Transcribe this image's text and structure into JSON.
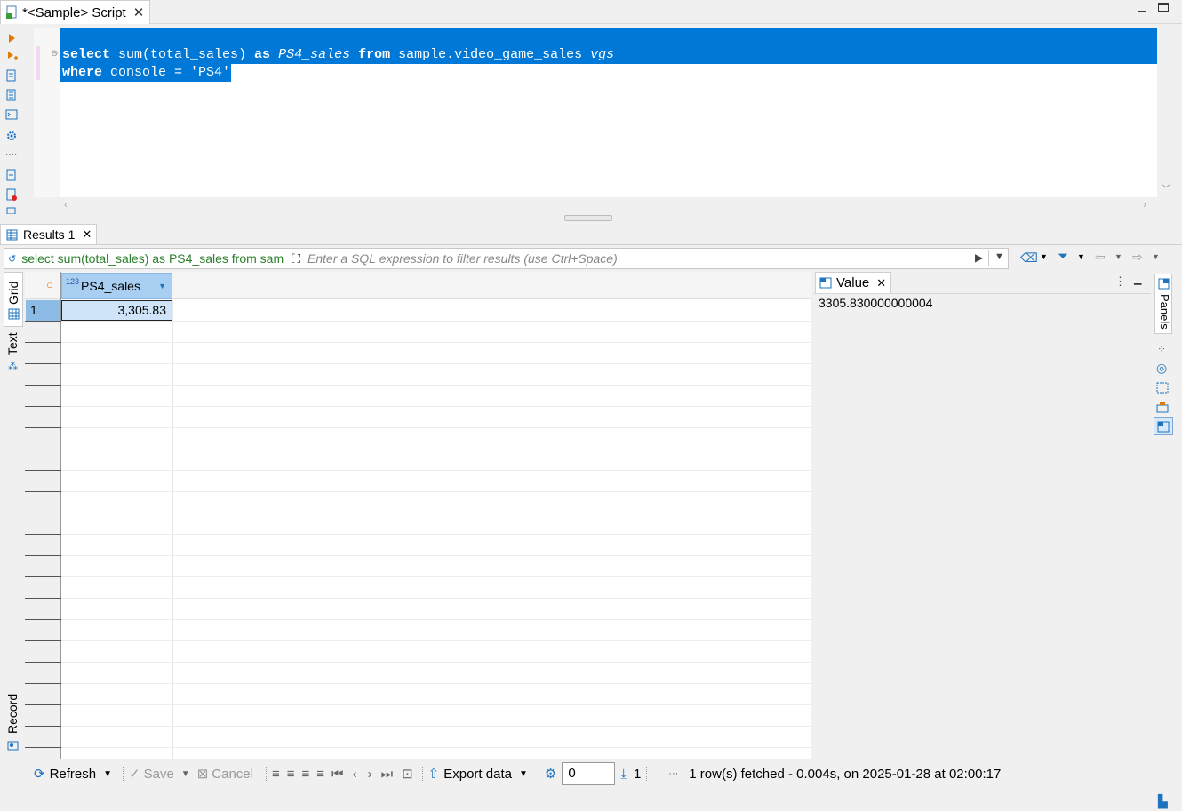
{
  "editor_tab": {
    "title": "*<Sample> Script"
  },
  "sql": {
    "line1": {
      "kw1": "select",
      "t1": " sum(total_sales) ",
      "kw2": "as",
      "t2": " ",
      "alias": "PS4_sales",
      "t3": " ",
      "kw3": "from",
      "t4": " sample.video_game_sales ",
      "alias2": "vgs"
    },
    "line2": {
      "kw1": "where",
      "t1": " console = 'PS4'"
    }
  },
  "results_tab": {
    "label": "Results 1"
  },
  "filter": {
    "query": "select sum(total_sales) as PS4_sales from sam",
    "placeholder": "Enter a SQL expression to filter results (use Ctrl+Space)"
  },
  "side_tabs": {
    "grid": "Grid",
    "text": "Text",
    "record": "Record"
  },
  "grid": {
    "column": {
      "type_badge": "123",
      "name": "PS4_sales"
    },
    "rows": [
      {
        "num": "1",
        "value": "3,305.83"
      }
    ]
  },
  "value_panel": {
    "title": "Value",
    "value": "3305.830000000004"
  },
  "panels_tab": {
    "label": "Panels"
  },
  "toolbar": {
    "refresh": "Refresh",
    "save": "Save",
    "cancel": "Cancel",
    "export": "Export data",
    "page_value": "0",
    "fetch_count": "1",
    "status": "1 row(s) fetched - 0.004s, on 2025-01-28 at 02:00:17"
  },
  "colors": {
    "selection": "#0078d7",
    "header_selected": "#a8cef2",
    "filter_query": "#2a7f2a"
  }
}
